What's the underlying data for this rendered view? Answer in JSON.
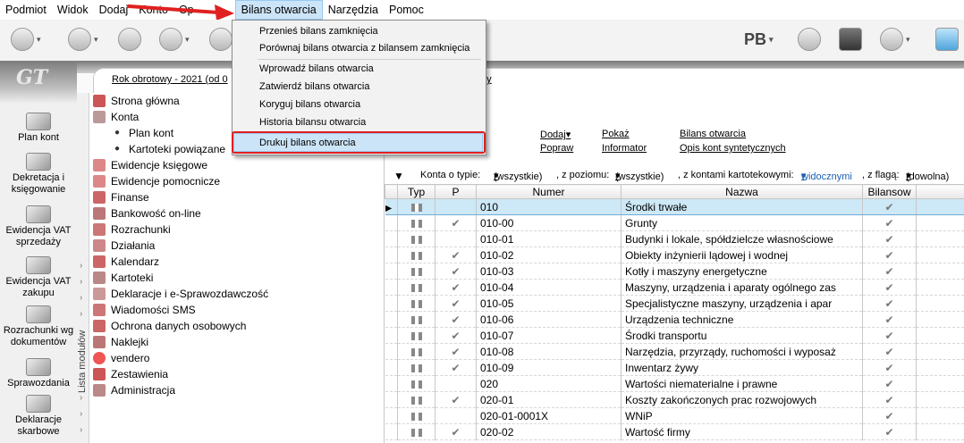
{
  "menubar": {
    "items": [
      "Podmiot",
      "Widok",
      "Dodaj",
      "Konto",
      "Op",
      "Bilans otwarcia",
      "Narzędzia",
      "Pomoc"
    ]
  },
  "toolbar": {
    "pb_label": "PB"
  },
  "left_bar": {
    "logo": "GT",
    "items": [
      "Plan kont",
      "Dekretacja i księgowanie",
      "Ewidencja VAT sprzedaży",
      "Ewidencja VAT zakupu",
      "Rozrachunki wg dokumentów",
      "Sprawozdania",
      "Deklaracje skarbowe"
    ]
  },
  "header": {
    "year_text": "Rok obrotowy - 2021  (od 0",
    "year_tail": "dy"
  },
  "modules_label": "Lista modułów",
  "tree": [
    "Strona główna",
    "Konta",
    "Plan kont",
    "Kartoteki powiązane",
    "Ewidencje księgowe",
    "Ewidencje pomocnicze",
    "Finanse",
    "Bankowość on-line",
    "Rozrachunki",
    "Działania",
    "Kalendarz",
    "Kartoteki",
    "Deklaracje i e-Sprawozdawczość",
    "Wiadomości SMS",
    "Ochrona danych osobowych",
    "Naklejki",
    "vendero",
    "Zestawienia",
    "Administracja"
  ],
  "actions": {
    "dodaj": "Dodaj",
    "popraw": "Popraw",
    "pokaz": "Pokaż",
    "informator": "Informator",
    "bilans": "Bilans otwarcia",
    "opis": "Opis kont syntetycznych"
  },
  "filter": {
    "t1": "Konta o typie:",
    "v1": "(wszystkie)",
    "t2": ", z poziomu:",
    "v2": "(wszystkie)",
    "t3": ", z kontami kartotekowymi:",
    "v3": "widocznymi",
    "t4": ", z flagą:",
    "v4": "(dowolna)"
  },
  "grid": {
    "columns": [
      "Typ",
      "P",
      "Numer",
      "Nazwa",
      "Bilansow"
    ],
    "rows": [
      {
        "p": false,
        "numer": "010",
        "nazwa": "Środki trwałe",
        "b": true
      },
      {
        "p": true,
        "numer": "010-00",
        "nazwa": "Grunty",
        "b": true
      },
      {
        "p": false,
        "numer": "010-01",
        "nazwa": "Budynki i lokale, spółdzielcze własnościowe",
        "b": true
      },
      {
        "p": true,
        "numer": "010-02",
        "nazwa": "Obiekty inżynierii lądowej i wodnej",
        "b": true
      },
      {
        "p": true,
        "numer": "010-03",
        "nazwa": "Kotły i maszyny energetyczne",
        "b": true
      },
      {
        "p": true,
        "numer": "010-04",
        "nazwa": "Maszyny, urządzenia i aparaty ogólnego zas",
        "b": true
      },
      {
        "p": true,
        "numer": "010-05",
        "nazwa": "Specjalistyczne maszyny, urządzenia i apar",
        "b": true
      },
      {
        "p": true,
        "numer": "010-06",
        "nazwa": "Urządzenia techniczne",
        "b": true
      },
      {
        "p": true,
        "numer": "010-07",
        "nazwa": "Środki transportu",
        "b": true
      },
      {
        "p": true,
        "numer": "010-08",
        "nazwa": "Narzędzia, przyrządy, ruchomości i wyposaż",
        "b": true
      },
      {
        "p": true,
        "numer": "010-09",
        "nazwa": "Inwentarz żywy",
        "b": true
      },
      {
        "p": false,
        "numer": "020",
        "nazwa": "Wartości niematerialne i prawne",
        "b": true
      },
      {
        "p": true,
        "numer": "020-01",
        "nazwa": "Koszty zakończonych prac rozwojowych",
        "b": true
      },
      {
        "p": false,
        "numer": "020-01-0001X",
        "nazwa": "WNiP",
        "b": true
      },
      {
        "p": true,
        "numer": "020-02",
        "nazwa": "Wartość firmy",
        "b": true
      }
    ]
  },
  "dropdown": {
    "items": [
      "Przenieś bilans zamknięcia",
      "Porównaj bilans otwarcia z bilansem zamknięcia",
      "Wprowadź bilans otwarcia",
      "Zatwierdź bilans otwarcia",
      "Koryguj bilans otwarcia",
      "Historia bilansu otwarcia",
      "Drukuj bilans otwarcia"
    ]
  }
}
